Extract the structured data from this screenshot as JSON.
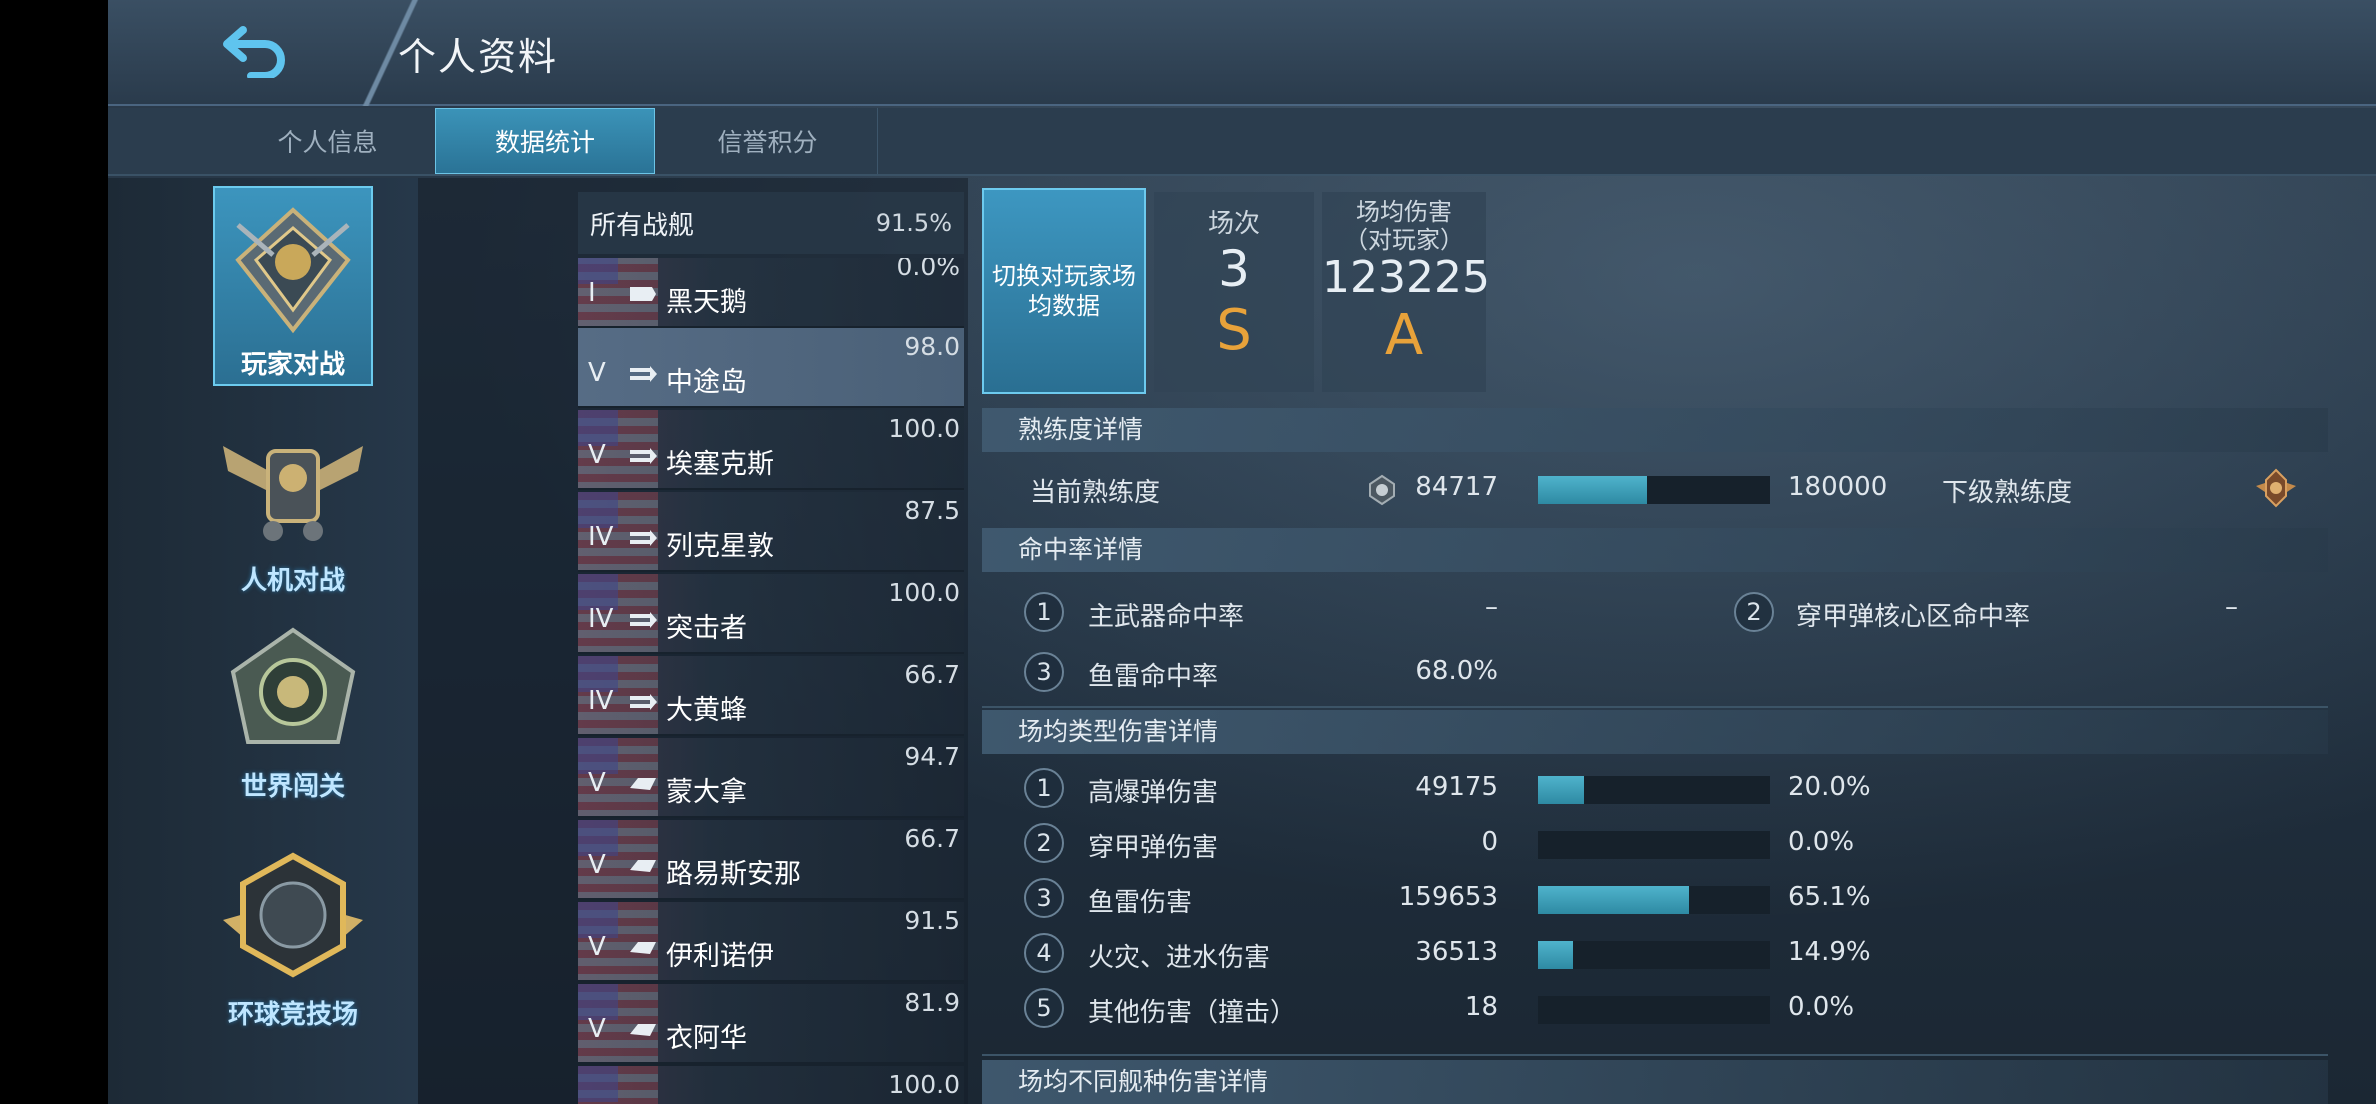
{
  "header": {
    "title": "个人资料",
    "back_icon": "back-arrow-icon"
  },
  "tabs": [
    {
      "label": "个人信息",
      "active": false
    },
    {
      "label": "数据统计",
      "active": true
    },
    {
      "label": "信誉积分",
      "active": false
    }
  ],
  "modes": [
    {
      "label": "玩家对战",
      "icon": "pvp-emblem-icon",
      "active": true
    },
    {
      "label": "人机对战",
      "icon": "pve-emblem-icon",
      "active": false
    },
    {
      "label": "世界闯关",
      "icon": "world-emblem-icon",
      "active": false
    },
    {
      "label": "环球竞技场",
      "icon": "arena-emblem-icon",
      "active": false
    }
  ],
  "ship_list": {
    "all_ships": {
      "label": "所有战舰",
      "pct": "91.5%"
    },
    "ships": [
      {
        "tier": "I",
        "name": "黑天鹅",
        "pct": "0.0%",
        "selected": false
      },
      {
        "tier": "V",
        "name": "中途岛",
        "pct": "98.0",
        "selected": true
      },
      {
        "tier": "V",
        "name": "埃塞克斯",
        "pct": "100.0",
        "selected": false
      },
      {
        "tier": "IV",
        "name": "列克星敦",
        "pct": "87.5",
        "selected": false
      },
      {
        "tier": "IV",
        "name": "突击者",
        "pct": "100.0",
        "selected": false
      },
      {
        "tier": "IV",
        "name": "大黄蜂",
        "pct": "66.7",
        "selected": false
      },
      {
        "tier": "V",
        "name": "蒙大拿",
        "pct": "94.7",
        "selected": false
      },
      {
        "tier": "V",
        "name": "路易斯安那",
        "pct": "66.7",
        "selected": false
      },
      {
        "tier": "V",
        "name": "伊利诺伊",
        "pct": "91.5",
        "selected": false
      },
      {
        "tier": "V",
        "name": "衣阿华",
        "pct": "81.9",
        "selected": false
      },
      {
        "tier": "",
        "name": "",
        "pct": "100.0",
        "selected": false
      }
    ]
  },
  "summary": {
    "switch_label": "切换对玩家场均数据",
    "cards": [
      {
        "label": "场次",
        "value": "3",
        "grade": "S"
      },
      {
        "label": "场均伤害\n（对玩家）",
        "value": "123225",
        "grade": "A"
      }
    ]
  },
  "proficiency": {
    "header": "熟练度详情",
    "current_label": "当前熟练度",
    "current_value": "84717",
    "max_value": "180000",
    "next_label": "下级熟练度",
    "progress": 0.47
  },
  "hit_rate": {
    "header": "命中率详情",
    "items": [
      {
        "num": "1",
        "label": "主武器命中率",
        "value": "–"
      },
      {
        "num": "2",
        "label": "穿甲弹核心区命中率",
        "value": "–"
      },
      {
        "num": "3",
        "label": "鱼雷命中率",
        "value": "68.0%"
      }
    ]
  },
  "damage_types": {
    "header": "场均类型伤害详情",
    "items": [
      {
        "num": "1",
        "label": "高爆弹伤害",
        "value": "49175",
        "pct": "20.0%",
        "ratio": 0.2
      },
      {
        "num": "2",
        "label": "穿甲弹伤害",
        "value": "0",
        "pct": "0.0%",
        "ratio": 0.0
      },
      {
        "num": "3",
        "label": "鱼雷伤害",
        "value": "159653",
        "pct": "65.1%",
        "ratio": 0.651
      },
      {
        "num": "4",
        "label": "火灾、进水伤害",
        "value": "36513",
        "pct": "14.9%",
        "ratio": 0.149
      },
      {
        "num": "5",
        "label": "其他伤害（撞击）",
        "value": "18",
        "pct": "0.0%",
        "ratio": 0.0
      }
    ]
  },
  "ship_class_damage": {
    "header": "场均不同舰种伤害详情"
  },
  "colors": {
    "accent": "#3b93b8",
    "grade": "#e8a23a",
    "bar": "#4fb3cc"
  }
}
